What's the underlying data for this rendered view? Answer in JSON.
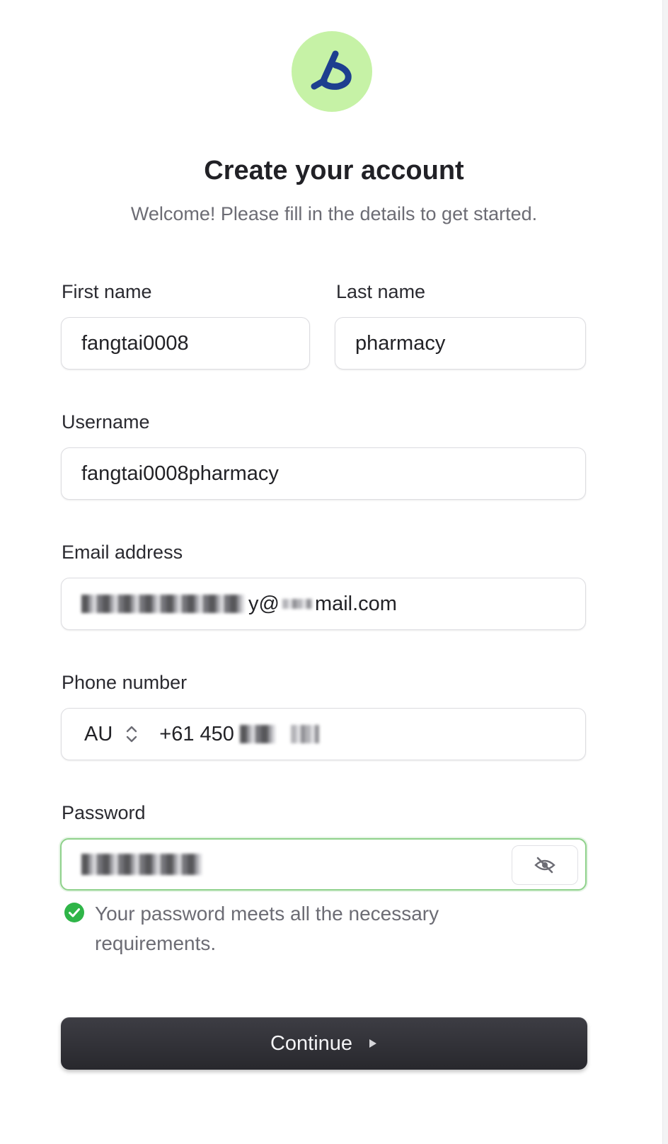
{
  "header": {
    "title": "Create your account",
    "subtitle": "Welcome! Please fill in the details to get started."
  },
  "form": {
    "first_name": {
      "label": "First name",
      "value": "fangtai0008"
    },
    "last_name": {
      "label": "Last name",
      "value": "pharmacy"
    },
    "username": {
      "label": "Username",
      "value": "fangtai0008pharmacy"
    },
    "email": {
      "label": "Email address",
      "value_visible_part": "y@",
      "value_suffix": "mail.com"
    },
    "phone": {
      "label": "Phone number",
      "country_code": "AU",
      "value_visible_part": "+61 450"
    },
    "password": {
      "label": "Password",
      "status": "Your password meets all the necessary requirements."
    }
  },
  "continue_button": {
    "label": "Continue"
  },
  "icons": {
    "logo": "logo-icon",
    "country_selector": "chevron-up-down-icon",
    "password_toggle": "eye-off-icon",
    "password_status": "check-circle-icon",
    "continue": "play-triangle-icon"
  },
  "colors": {
    "logo_background": "#c6f2a6",
    "logo_mark": "#1d3f8f",
    "success": "#2fb548",
    "button": "#2f2f35"
  }
}
